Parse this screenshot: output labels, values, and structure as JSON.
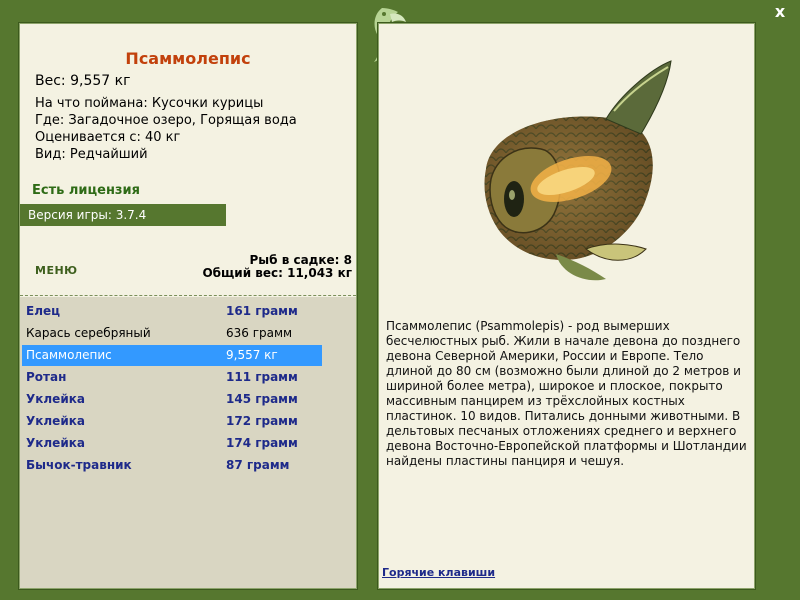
{
  "fish": {
    "title": "Псаммолепис",
    "weight_line": "Вес: 9,557 кг",
    "caught_with": "На что поймана: Кусочки курицы",
    "location": "Где: Загадочное озеро, Горящая вода",
    "valued_from": "Оценивается с: 40 кг",
    "rarity": "Вид: Редчайший",
    "license": "Есть лицензия",
    "version": "Версия игры: 3.7.4",
    "description": "Псаммолепис (Psammolepis) - род вымерших бесчелюстных рыб. Жили в начале девона до позднего девона Северной Америки, России и Европе. Тело длиной до 80 см (возможно были длиной до 2 метров и шириной более метра), широкое и плоское, покрыто массивным панцирем из трёхслойных костных пластинок. 10 видов. Питались донными животными. В дельтовых песчаных отложениях среднего и верхнего девона Восточно-Европейской платформы и Шотландии найдены пластины панциря и чешуя."
  },
  "menu": {
    "label": "МЕНЮ"
  },
  "cage": {
    "count": "Рыб в садке: 8",
    "total_weight": "Общий вес: 11,043 кг"
  },
  "fish_list": [
    {
      "name": "Елец",
      "weight": "161 грамм",
      "style": "bold"
    },
    {
      "name": "Карась серебряный",
      "weight": "636 грамм",
      "style": "normal"
    },
    {
      "name": "Псаммолепис",
      "weight": "9,557 кг",
      "style": "selected"
    },
    {
      "name": "Ротан",
      "weight": "111 грамм",
      "style": "bold"
    },
    {
      "name": "Уклейка",
      "weight": "145 грамм",
      "style": "bold"
    },
    {
      "name": "Уклейка",
      "weight": "172 грамм",
      "style": "bold"
    },
    {
      "name": "Уклейка",
      "weight": "174 грамм",
      "style": "bold"
    },
    {
      "name": "Бычок-травник",
      "weight": "87 грамм",
      "style": "bold"
    }
  ],
  "links": {
    "hotkeys": "Горячие клавиши"
  },
  "window": {
    "close_label": "x"
  },
  "colors": {
    "frame": "#56772f",
    "panel": "#f4f2e2",
    "list_bg": "#d9d6c2",
    "selection": "#3399ff",
    "title": "#c2410c"
  },
  "icons": {
    "emblem": "fish-emblem-icon",
    "close": "close-icon"
  }
}
